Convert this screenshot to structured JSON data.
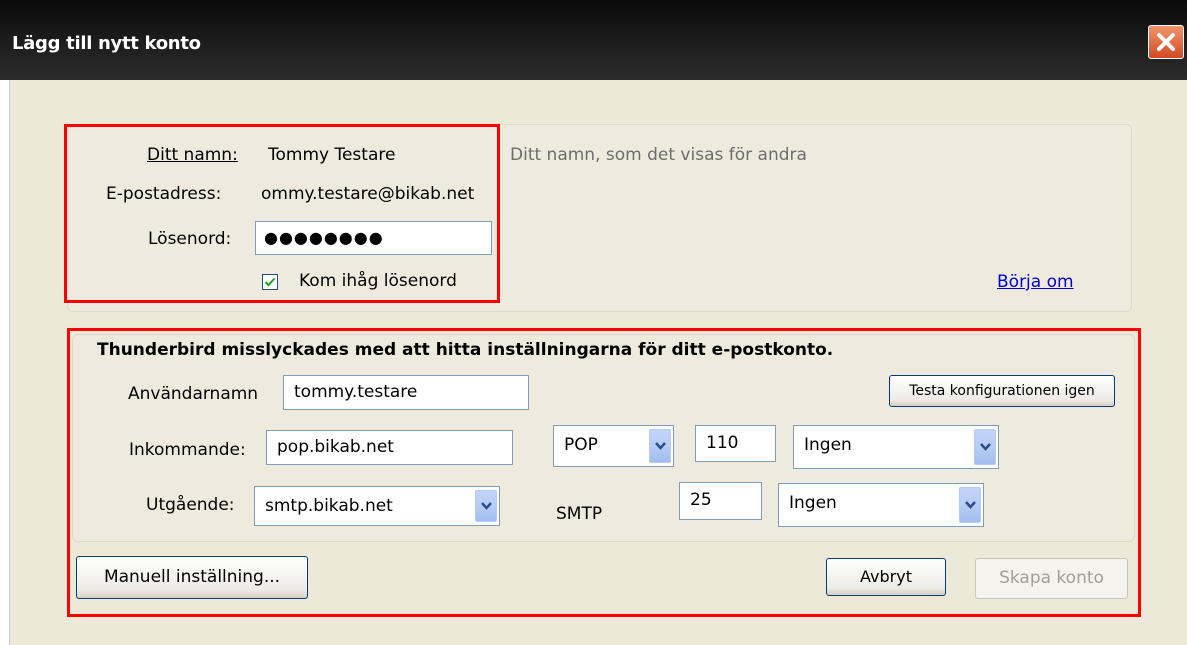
{
  "window": {
    "title": "Lägg till nytt konto"
  },
  "account": {
    "name_label": "Ditt namn:",
    "name_value": "Tommy Testare",
    "name_hint": "Ditt namn, som det visas för andra",
    "email_label": "E-postadress:",
    "email_value": "ommy.testare@bikab.net",
    "password_label": "Lösenord:",
    "password_value": "●●●●●●●●",
    "remember_label": "Kom ihåg lösenord",
    "remember_checked": true,
    "restart_link": "Börja om"
  },
  "config": {
    "error_message": "Thunderbird misslyckades med att hitta inställningarna för ditt e-postkonto.",
    "username_label": "Användarnamn",
    "username_value": "tommy.testare",
    "retest_button": "Testa konfigurationen igen",
    "incoming_label": "Inkommande:",
    "incoming_server": "pop.bikab.net",
    "incoming_protocol": "POP",
    "incoming_port": "110",
    "incoming_security": "Ingen",
    "outgoing_label": "Utgående:",
    "outgoing_server": "smtp.bikab.net",
    "outgoing_protocol": "SMTP",
    "outgoing_port": "25",
    "outgoing_security": "Ingen"
  },
  "buttons": {
    "manual": "Manuell inställning...",
    "cancel": "Avbryt",
    "create": "Skapa konto"
  },
  "colors": {
    "highlight": "#ff0000",
    "link": "#0000cc",
    "dialog_bg": "#ece9d8"
  }
}
